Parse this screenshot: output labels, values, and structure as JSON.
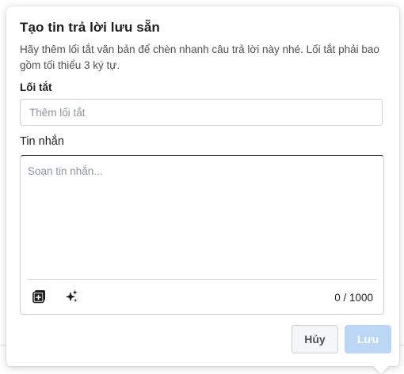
{
  "dialog": {
    "title": "Tạo tin trả lời lưu sẵn",
    "description": "Hãy thêm lối tắt văn bản để chèn nhanh câu trả lời này nhé. Lối tắt phải bao gồm tối thiểu 3 ký tự."
  },
  "shortcut": {
    "label": "Lối tắt",
    "placeholder": "Thêm lối tắt",
    "value": ""
  },
  "message": {
    "label": "Tin nhắn",
    "placeholder": "Soạn tin nhắn...",
    "value": "",
    "counter": "0 / 1000",
    "tools": [
      "add-attachment-icon",
      "ai-sparkle-icon"
    ]
  },
  "actions": {
    "cancel_label": "Hủy",
    "save_label": "Lưu"
  },
  "colors": {
    "save_disabled_bg": "#bcd7f5",
    "text_primary": "#1c1e21",
    "text_secondary": "#4b4f56",
    "border": "#ccd0d5"
  }
}
